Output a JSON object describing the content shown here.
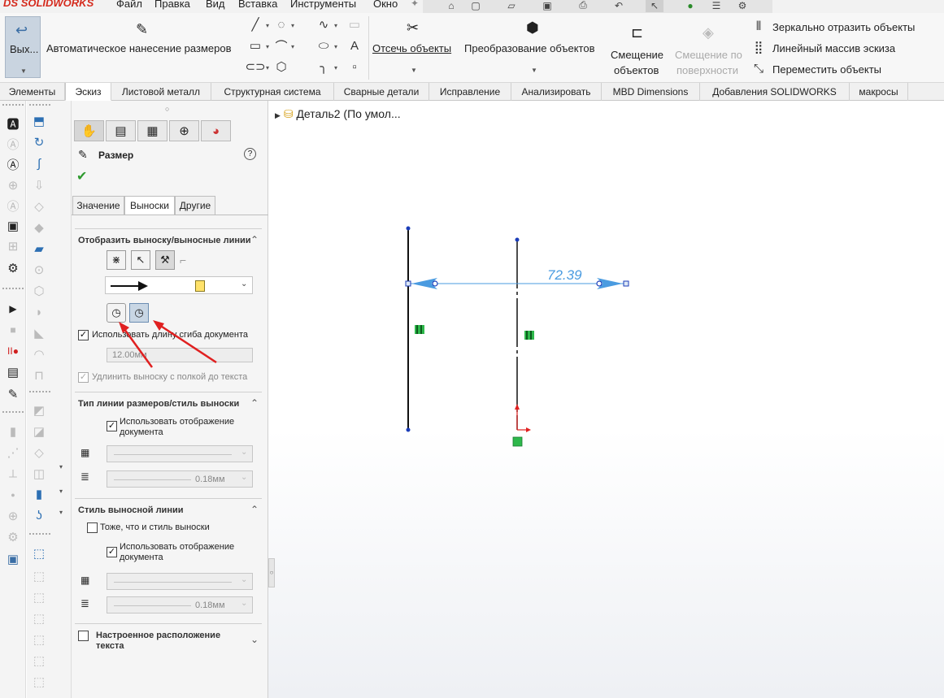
{
  "app": {
    "logo": "SOLIDWORKS",
    "logo_prefix": "DS"
  },
  "menu": [
    "Файл",
    "Правка",
    "Вид",
    "Вставка",
    "Инструменты",
    "Окно"
  ],
  "ribbon": {
    "exit_sketch": "Вых...",
    "smart_dimension": "Автоматическое нанесение размеров",
    "trim": "Отсечь объекты",
    "convert": "Преобразование объектов",
    "offset_line1": "Смещение",
    "offset_line2": "объектов",
    "offset_surface_line1": "Смещение по",
    "offset_surface_line2": "поверхности",
    "mirror": "Зеркально отразить объекты",
    "linear_pattern": "Линейный массив эскиза",
    "move": "Переместить объекты"
  },
  "tabs": [
    "Элементы",
    "Эскиз",
    "Листовой металл",
    "Структурная система",
    "Сварные детали",
    "Исправление",
    "Анализировать",
    "MBD Dimensions",
    "Добавления SOLIDWORKS",
    "макросы"
  ],
  "active_tab": "Эскиз",
  "pm": {
    "title": "Размер",
    "subtabs": [
      "Значение",
      "Выноски",
      "Другие"
    ],
    "active_subtab": "Выноски",
    "section1": {
      "title": "Отобразить выноску/выносные линии",
      "use_bend_length": "Использовать длину сгиба документа",
      "bend_length_value": "12.00мм",
      "extend_leader": "Удлинить выноску с полкой до текста"
    },
    "section2": {
      "title": "Тип линии размеров/стиль выноски",
      "use_doc_display_l1": "Использовать отображение",
      "use_doc_display_l2": "документа",
      "thickness": "0.18мм"
    },
    "section3": {
      "title": "Стиль выносной линии",
      "same_as_leader": "Тоже, что и стиль выноски",
      "use_doc_display_l1": "Использовать отображение",
      "use_doc_display_l2": "документа",
      "thickness": "0.18мм"
    },
    "section4": {
      "title_l1": "Настроенное расположение",
      "title_l2": "текста"
    }
  },
  "tree": {
    "part": "Деталь2",
    "config": "(По умол..."
  },
  "drawing": {
    "dimension_value": "72.39"
  },
  "colors": {
    "accent": "#d52b1e",
    "dim_blue": "#4a9be0",
    "relation_green": "#2eb84b",
    "arrow_red": "#e02020"
  }
}
